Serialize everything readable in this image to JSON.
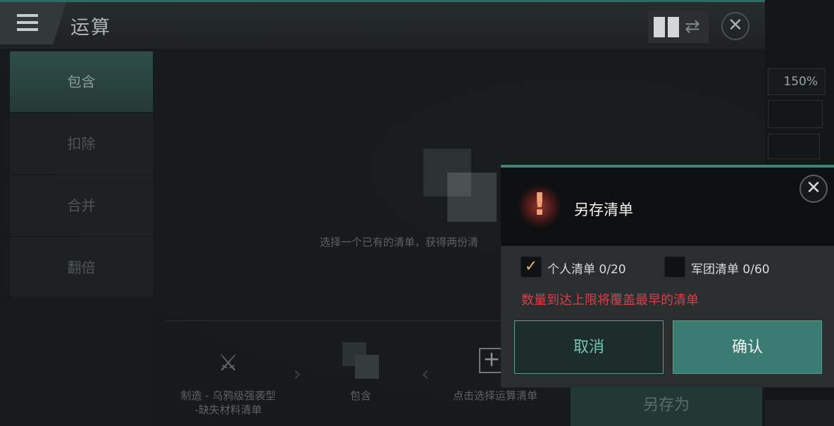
{
  "calc": {
    "title": "运算",
    "side_tabs": [
      {
        "label": "包含",
        "active": true
      },
      {
        "label": "扣除",
        "active": false
      },
      {
        "label": "合并",
        "active": false
      },
      {
        "label": "翻倍",
        "active": false
      }
    ],
    "hint_text": "选择一个已有的清单，获得两份清",
    "flow": {
      "source_label": "制造 - 乌鸦级强袭型\n-缺失材料清单",
      "operation_label": "包含",
      "target_label": "点击选择运算清单"
    },
    "save_as_label": "另存为",
    "side_zoom": "150%"
  },
  "dialog": {
    "title": "另存清单",
    "options": [
      {
        "label": "个人清单 0/20",
        "checked": true
      },
      {
        "label": "军团清单 0/60",
        "checked": false
      }
    ],
    "warning": "数量到达上限将覆盖最早的清单",
    "cancel_label": "取消",
    "confirm_label": "确认"
  },
  "icons": {
    "menu": "hamburger-icon",
    "layout": "layout-toggle-icon",
    "close": "close-icon",
    "warning": "exclamation-icon",
    "check": "checkmark-icon",
    "add": "plus-icon",
    "crafting": "crossed-tools-icon"
  },
  "colors": {
    "accent": "#3d8377",
    "warning_text": "#d2414b",
    "confirm_bg": "#3b7c72"
  }
}
